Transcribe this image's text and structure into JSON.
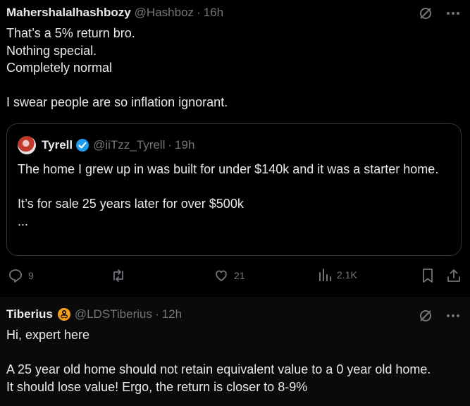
{
  "tweet1": {
    "name": "Mahershalalhashbozy",
    "handle": "@Hashboz",
    "sep": "·",
    "time": "16h",
    "lines": [
      "That’s a 5% return bro.",
      "Nothing special.",
      "Completely normal",
      "",
      "I swear people are so inflation ignorant."
    ],
    "quote": {
      "name": "Tyrell",
      "handle": "@iiTzz_Tyrell",
      "sep": "·",
      "time": "19h",
      "lines": [
        "The home I grew up in was built for under $140k and it was a starter home.",
        "",
        "It’s for sale 25 years later for over $500k",
        "..."
      ]
    },
    "actions": {
      "replies": "9",
      "retweets": "",
      "likes": "21",
      "views": "2.1K"
    }
  },
  "tweet2": {
    "name": "Tiberius",
    "handle": "@LDSTiberius",
    "sep": "·",
    "time": "12h",
    "lines": [
      "Hi, expert here",
      "",
      "A 25 year old home should not retain equivalent value to a 0 year old home.",
      "It should lose value! Ergo, the return is closer to 8-9%"
    ]
  },
  "colors": {
    "text": "#e7e9ea",
    "muted": "#71767b",
    "verified": "#1d9bf0",
    "border": "#2f3336",
    "badge": "#f4a01c"
  }
}
